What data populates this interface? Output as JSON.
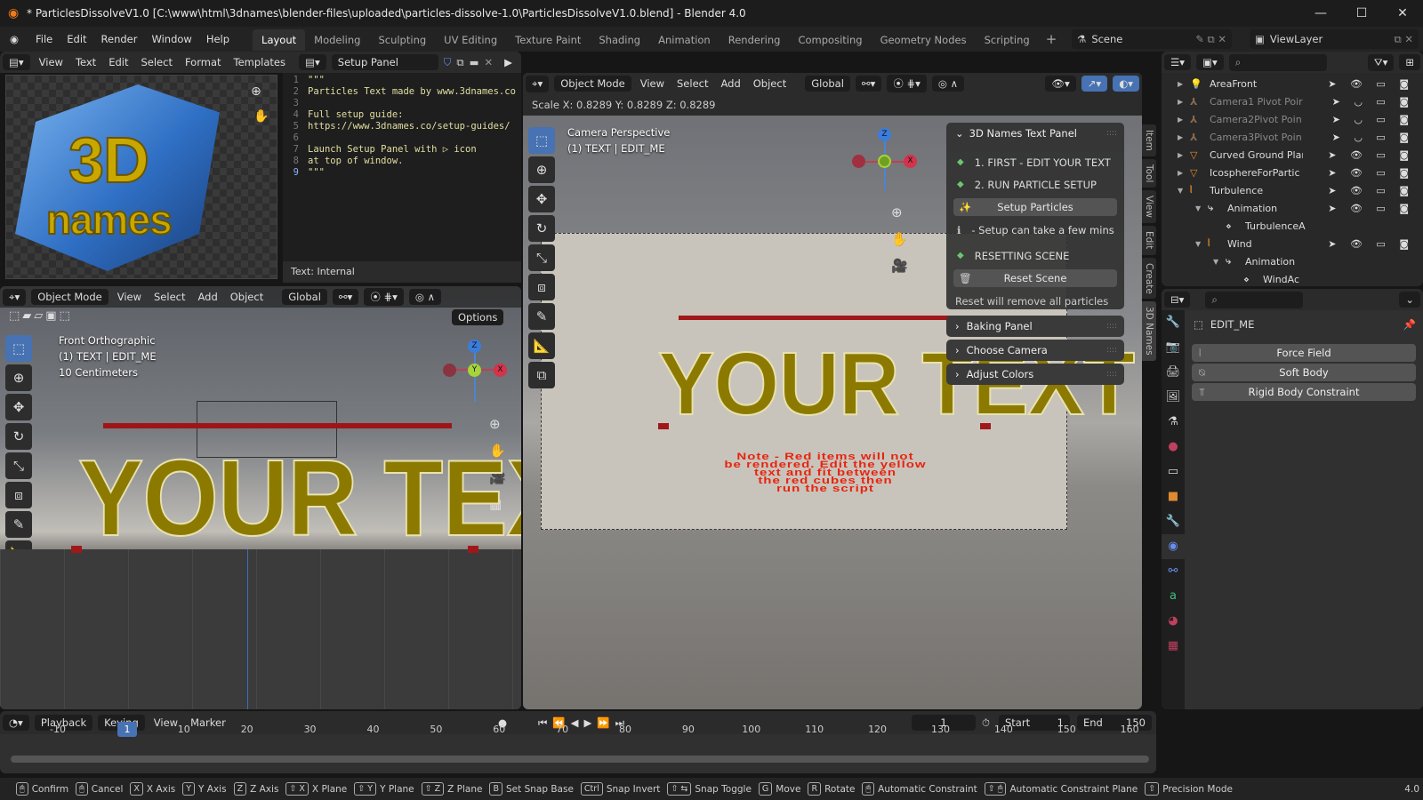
{
  "title": "* ParticlesDissolveV1.0 [C:\\www\\html\\3dnames\\blender-files\\uploaded\\particles-dissolve-1.0\\ParticlesDissolveV1.0.blend] - Blender 4.0",
  "menu": [
    "File",
    "Edit",
    "Render",
    "Window",
    "Help"
  ],
  "workspaces": [
    "Layout",
    "Modeling",
    "Sculpting",
    "UV Editing",
    "Texture Paint",
    "Shading",
    "Animation",
    "Rendering",
    "Compositing",
    "Geometry Nodes",
    "Scripting"
  ],
  "active_workspace": "Layout",
  "scene": "Scene",
  "view_layer": "ViewLayer",
  "text_editor": {
    "menu": [
      "View",
      "Text",
      "Edit",
      "Select",
      "Format",
      "Templates"
    ],
    "text_name": "Setup Panel",
    "footer": "Text: Internal",
    "lines": [
      "\"\"\"",
      "Particles Text made by www.3dnames.co",
      "",
      "Full setup guide:",
      "https://www.3dnames.co/setup-guides/",
      "",
      "Launch Setup Panel with ▷ icon",
      "at top of window.",
      "\"\"\""
    ]
  },
  "logo": {
    "text1": "3D",
    "text2": "names"
  },
  "viewport_menu": {
    "mode": "Object Mode",
    "items": [
      "View",
      "Select",
      "Add",
      "Object"
    ],
    "orientation": "Global",
    "options": "Options"
  },
  "left_viewport": {
    "view": "Front Orthographic",
    "object": "(1) TEXT | EDIT_ME",
    "scale": "10 Centimeters",
    "big_text": "YOUR TEXT"
  },
  "camera_viewport": {
    "operator": "Scale X: 0.8289   Y: 0.8289   Z: 0.8289",
    "view": "Camera Perspective",
    "object": "(1) TEXT | EDIT_ME",
    "big_text": "YOUR TEXT",
    "note": [
      "Note - Red items will not",
      "be rendered. Edit the yellow",
      "text and fit between",
      "the red cubes then",
      "run the script"
    ],
    "note_color": "#e8230f",
    "text_color": "#8c7a00"
  },
  "npanel": {
    "title": "3D Names Text Panel",
    "step1": "1. FIRST - EDIT YOUR TEXT",
    "step2": "2. RUN PARTICLE SETUP",
    "setup_btn": "Setup Particles",
    "info": "- Setup can take a few mins",
    "reset_label": "RESETTING SCENE",
    "reset_btn": "Reset Scene",
    "reset_note": "Reset will remove all particles",
    "collapsed": [
      "Baking Panel",
      "Choose Camera",
      "Adjust Colors"
    ],
    "tabs": [
      "Item",
      "Tool",
      "View",
      "Edit",
      "Create",
      "3D Names"
    ]
  },
  "outliner": [
    {
      "name": "AreaFront",
      "icon": "light-icon",
      "color": "#e0a040",
      "dim": false,
      "depth": 0,
      "open": false
    },
    {
      "name": "Camera1 Pivot Poir",
      "icon": "empty-icon",
      "color": "#8a6a50",
      "dim": true,
      "depth": 0,
      "open": false
    },
    {
      "name": "Camera2Pivot Poin",
      "icon": "empty-icon",
      "color": "#8a6a50",
      "dim": true,
      "depth": 0,
      "open": false
    },
    {
      "name": "Camera3Pivot Poin",
      "icon": "empty-icon",
      "color": "#8a6a50",
      "dim": true,
      "depth": 0,
      "open": false
    },
    {
      "name": "Curved Ground Plar",
      "icon": "mesh-icon",
      "color": "#e08a30",
      "dim": false,
      "depth": 0,
      "open": false
    },
    {
      "name": "IcosphereForPartic",
      "icon": "mesh-icon",
      "color": "#e08a30",
      "dim": false,
      "depth": 0,
      "open": false
    },
    {
      "name": "Turbulence",
      "icon": "force-icon",
      "color": "#e08a30",
      "dim": false,
      "depth": 0,
      "open": true
    },
    {
      "name": "Animation",
      "icon": "animation-icon",
      "color": "#ccc",
      "dim": false,
      "depth": 1,
      "open": true
    },
    {
      "name": "TurbulenceA",
      "icon": "action-icon",
      "color": "#ccc",
      "dim": false,
      "depth": 2,
      "open": null
    },
    {
      "name": "Wind",
      "icon": "force-icon",
      "color": "#e08a30",
      "dim": false,
      "depth": 1,
      "open": true
    },
    {
      "name": "Animation",
      "icon": "animation-icon",
      "color": "#ccc",
      "dim": false,
      "depth": 2,
      "open": true
    },
    {
      "name": "WindAc",
      "icon": "action-icon",
      "color": "#ccc",
      "dim": false,
      "depth": 3,
      "open": null
    }
  ],
  "properties": {
    "object": "EDIT_ME",
    "buttons": [
      "Force Field",
      "Soft Body",
      "Rigid Body Constraint"
    ],
    "active_tab": "physics"
  },
  "timeline": {
    "menu": [
      "Playback",
      "Keying",
      "View",
      "Marker"
    ],
    "current": "1",
    "start_label": "Start",
    "start": "1",
    "end_label": "End",
    "end": "150",
    "ticks": [
      "-10",
      "10",
      "20",
      "30",
      "40",
      "50",
      "60",
      "70",
      "80",
      "90",
      "100",
      "110",
      "120",
      "130",
      "140",
      "150",
      "160"
    ],
    "playhead": "1"
  },
  "status": [
    {
      "key": "🖱",
      "label": "Confirm"
    },
    {
      "key": "🖱",
      "label": "Cancel"
    },
    {
      "key": "X",
      "label": "X Axis"
    },
    {
      "key": "Y",
      "label": "Y Axis"
    },
    {
      "key": "Z",
      "label": "Z Axis"
    },
    {
      "key": "⇧ X",
      "label": "X Plane"
    },
    {
      "key": "⇧ Y",
      "label": "Y Plane"
    },
    {
      "key": "⇧ Z",
      "label": "Z Plane"
    },
    {
      "key": "B",
      "label": "Set Snap Base"
    },
    {
      "key": "Ctrl",
      "label": "Snap Invert"
    },
    {
      "key": "⇧ ⇆",
      "label": "Snap Toggle"
    },
    {
      "key": "G",
      "label": "Move"
    },
    {
      "key": "R",
      "label": "Rotate"
    },
    {
      "key": "🖱",
      "label": "Automatic Constraint"
    },
    {
      "key": "⇧ 🖱",
      "label": "Automatic Constraint Plane"
    },
    {
      "key": "⇧",
      "label": "Precision Mode"
    }
  ],
  "version": "4.0"
}
